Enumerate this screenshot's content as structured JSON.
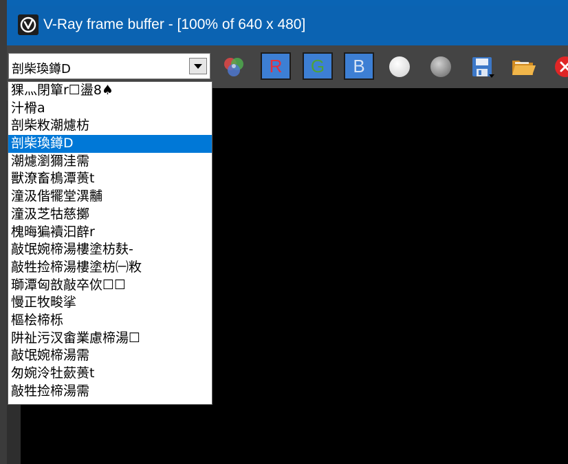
{
  "window": {
    "title": "V-Ray frame buffer - [100% of 640 x 480]"
  },
  "toolbar": {
    "channel_select_value": "剖柴瑍鐏D",
    "buttons": [
      {
        "name": "color-channels-icon"
      },
      {
        "name": "red-channel-button",
        "label": "R"
      },
      {
        "name": "green-channel-button",
        "label": "G"
      },
      {
        "name": "blue-channel-button",
        "label": "B"
      },
      {
        "name": "white-circle-icon"
      },
      {
        "name": "gray-circle-icon"
      },
      {
        "name": "save-icon"
      },
      {
        "name": "open-folder-icon"
      },
      {
        "name": "close-icon"
      }
    ]
  },
  "dropdown": {
    "items": [
      "猓灬閉簞r☐盪8♠",
      "汁榾a",
      "剖柴敉潮爈枋",
      "剖柴瑍鐏D",
      "潮爈瀏獮洼需",
      "獸潦畜樢潭蒉t",
      "潼汲偕犤堂潩黼",
      "潼汲芝牯慈擲",
      "槐晦猵襩汩辪r",
      "敲氓婉楴湯樓塗枋麸-",
      "敲牲捡楴湯樓塗枋㈠敉",
      "瑡潭匈敨敲卒佽☐☐",
      "慢正牧畯挲",
      "樞桧楴栎",
      "阱祉污汊畬業慮楴湯☐",
      "敲氓婉楴湯需",
      "匆婉泠牡蘝蒉t",
      "敲牲捡楴湯需"
    ],
    "selected_index": 3
  },
  "colors": {
    "title_bar": "#0b63b2",
    "selection": "#0078d7",
    "rgb_button_bg": "#3d7fd4"
  }
}
